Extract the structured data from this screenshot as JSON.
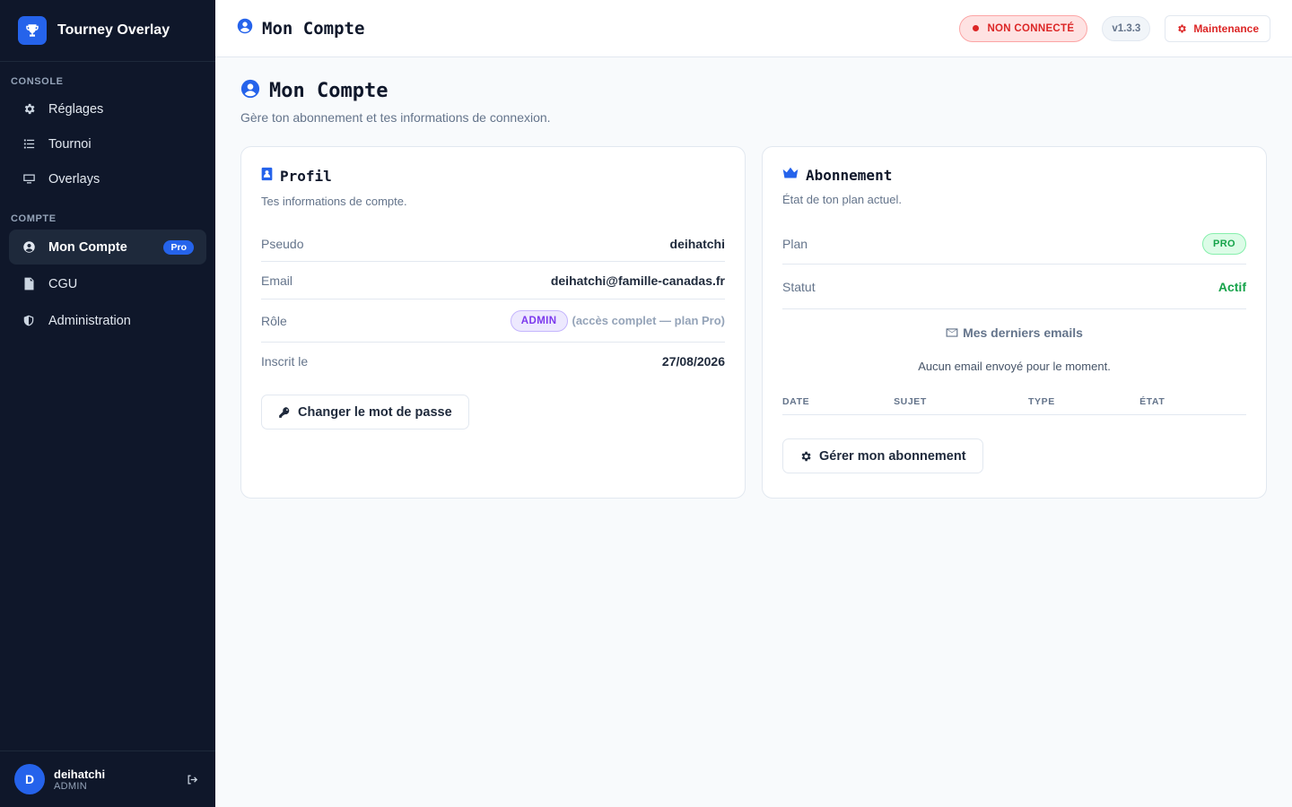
{
  "app": {
    "name": "Tourney Overlay"
  },
  "sidebar": {
    "section_console": "CONSOLE",
    "section_compte": "COMPTE",
    "console_items": [
      {
        "label": "Réglages",
        "icon": "gear-icon"
      },
      {
        "label": "Tournoi",
        "icon": "list-icon"
      },
      {
        "label": "Overlays",
        "icon": "monitor-icon"
      }
    ],
    "compte_items": [
      {
        "label": "Mon Compte",
        "icon": "user-circle-icon",
        "badge": "Pro",
        "active": true
      },
      {
        "label": "CGU",
        "icon": "document-icon"
      },
      {
        "label": "Administration",
        "icon": "shield-icon"
      }
    ],
    "user": {
      "initial": "D",
      "name": "deihatchi",
      "role": "ADMIN"
    }
  },
  "topbar": {
    "title": "Mon Compte",
    "status": "NON CONNECTÉ",
    "version": "v1.3.3",
    "maintenance": "Maintenance"
  },
  "page": {
    "title": "Mon Compte",
    "subtitle": "Gère ton abonnement et tes informations de connexion."
  },
  "profile": {
    "title": "Profil",
    "subtitle": "Tes informations de compte.",
    "pseudo_label": "Pseudo",
    "pseudo_value": "deihatchi",
    "email_label": "Email",
    "email_value": "deihatchi@famille-canadas.fr",
    "role_label": "Rôle",
    "role_badge": "ADMIN",
    "role_note": "(accès complet — plan Pro)",
    "joined_label": "Inscrit le",
    "joined_value": "27/08/2026",
    "change_password": "Changer le mot de passe"
  },
  "subscription": {
    "title": "Abonnement",
    "subtitle": "État de ton plan actuel.",
    "plan_label": "Plan",
    "plan_badge": "PRO",
    "status_label": "Statut",
    "status_value": "Actif",
    "emails_title": "Mes derniers emails",
    "emails_empty": "Aucun email envoyé pour le moment.",
    "columns": [
      "DATE",
      "SUJET",
      "TYPE",
      "ÉTAT"
    ],
    "manage_button": "Gérer mon abonnement"
  },
  "colors": {
    "sidebar_bg": "#0f172a",
    "accent": "#2563eb",
    "danger": "#dc2626",
    "success": "#16a34a",
    "admin_purple": "#7c3aed"
  }
}
